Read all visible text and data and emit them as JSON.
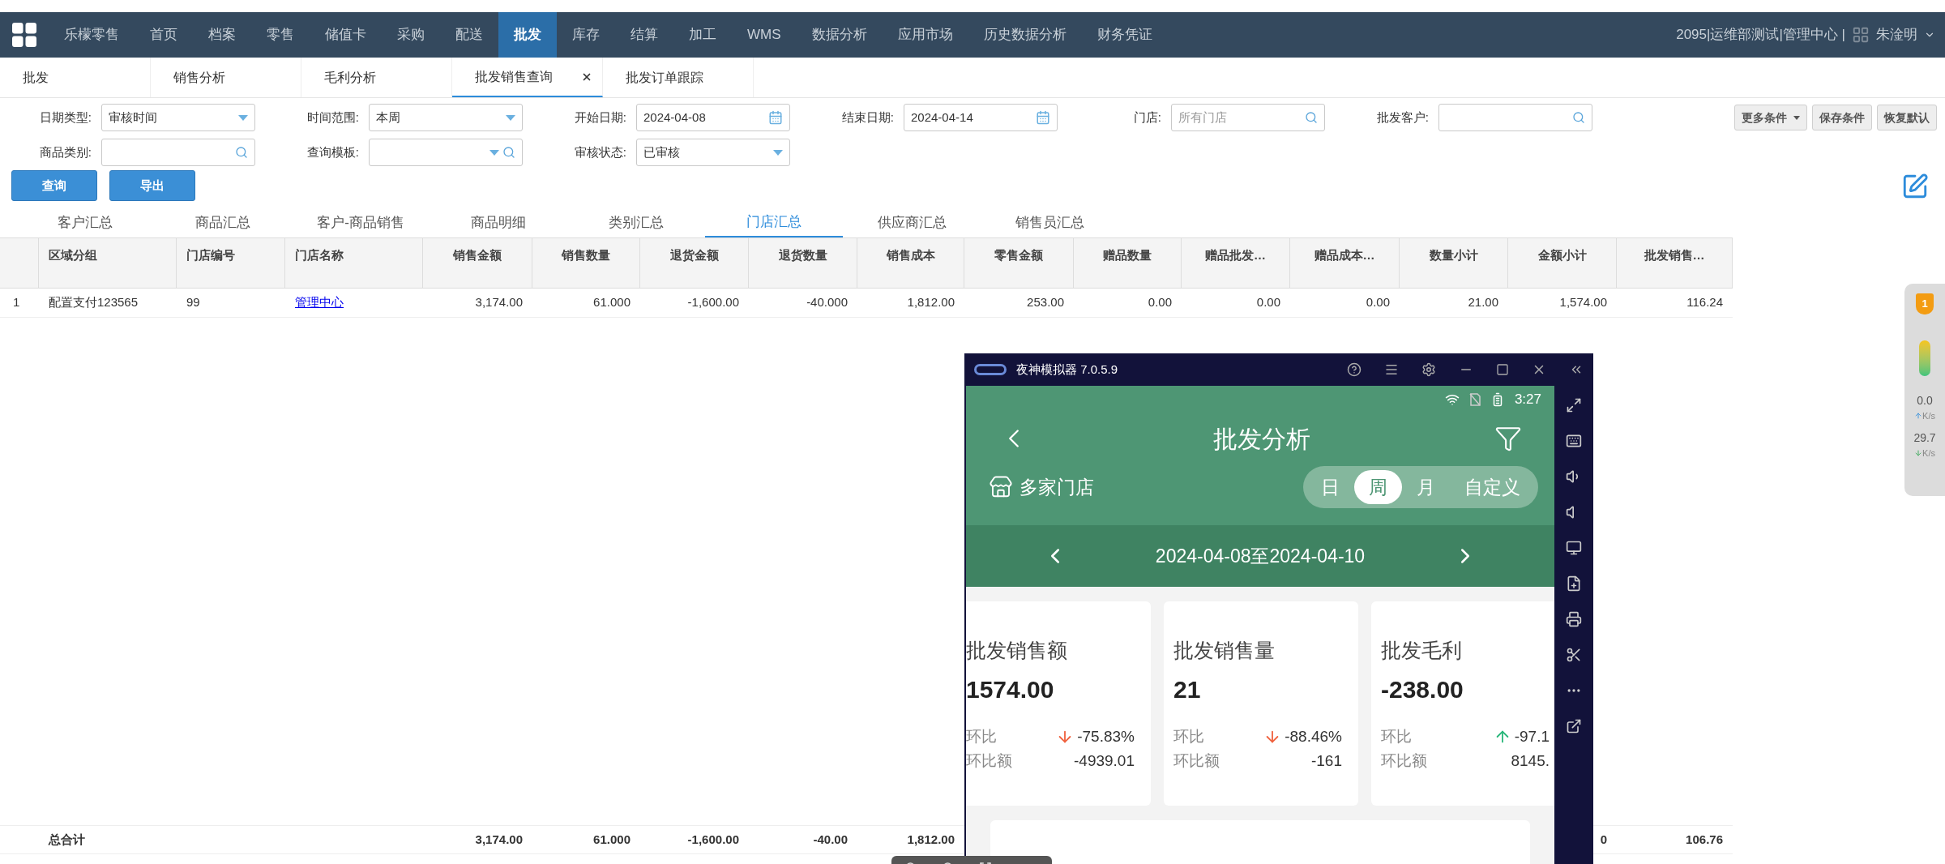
{
  "nav": {
    "items": [
      {
        "label": "乐檬零售",
        "selected": false
      },
      {
        "label": "首页",
        "selected": false
      },
      {
        "label": "档案",
        "selected": false
      },
      {
        "label": "零售",
        "selected": false
      },
      {
        "label": "储值卡",
        "selected": false
      },
      {
        "label": "采购",
        "selected": false
      },
      {
        "label": "配送",
        "selected": false
      },
      {
        "label": "批发",
        "selected": true
      },
      {
        "label": "库存",
        "selected": false
      },
      {
        "label": "结算",
        "selected": false
      },
      {
        "label": "加工",
        "selected": false
      },
      {
        "label": "WMS",
        "selected": false
      },
      {
        "label": "数据分析",
        "selected": false
      },
      {
        "label": "应用市场",
        "selected": false
      },
      {
        "label": "历史数据分析",
        "selected": false
      },
      {
        "label": "财务凭证",
        "selected": false
      }
    ],
    "org": "2095|运维部测试|管理中心 |",
    "user": "朱淦明"
  },
  "tabs": [
    {
      "label": "批发",
      "selected": false,
      "closable": false
    },
    {
      "label": "销售分析",
      "selected": false,
      "closable": false
    },
    {
      "label": "毛利分析",
      "selected": false,
      "closable": false
    },
    {
      "label": "批发销售查询",
      "selected": true,
      "closable": true
    },
    {
      "label": "批发订单跟踪",
      "selected": false,
      "closable": false
    }
  ],
  "filter_rows": [
    [
      {
        "label": "日期类型:",
        "kind": "select",
        "value": "审核时间"
      },
      {
        "label": "时间范围:",
        "kind": "select",
        "value": "本周"
      },
      {
        "label": "开始日期:",
        "kind": "date",
        "value": "2024-04-08"
      },
      {
        "label": "结束日期:",
        "kind": "date",
        "value": "2024-04-14"
      },
      {
        "label": "门店:",
        "kind": "search",
        "placeholder": "所有门店"
      },
      {
        "label": "批发客户:",
        "kind": "search"
      }
    ],
    [
      {
        "label": "商品类别:",
        "kind": "search"
      },
      {
        "label": "查询模板:",
        "kind": "select-search"
      },
      {
        "label": "审核状态:",
        "kind": "select",
        "value": "已审核"
      }
    ]
  ],
  "option_buttons": [
    {
      "label": "更多条件",
      "kind": "dropdown"
    },
    {
      "label": "保存条件",
      "kind": "plain"
    },
    {
      "label": "恢复默认",
      "kind": "plain"
    }
  ],
  "action_buttons": [
    "查询",
    "导出"
  ],
  "report_tabs": [
    {
      "label": "客户汇总",
      "selected": false
    },
    {
      "label": "商品汇总",
      "selected": false
    },
    {
      "label": "客户-商品销售",
      "selected": false
    },
    {
      "label": "商品明细",
      "selected": false
    },
    {
      "label": "类别汇总",
      "selected": false
    },
    {
      "label": "门店汇总",
      "selected": true
    },
    {
      "label": "供应商汇总",
      "selected": false
    },
    {
      "label": "销售员汇总",
      "selected": false
    }
  ],
  "table": {
    "columns": [
      {
        "label": "区域分组",
        "kind": "text"
      },
      {
        "label": "门店编号",
        "kind": "text"
      },
      {
        "label": "门店名称",
        "kind": "link"
      },
      {
        "label": "销售金额",
        "kind": "number"
      },
      {
        "label": "销售数量",
        "kind": "number"
      },
      {
        "label": "退货金额",
        "kind": "number"
      },
      {
        "label": "退货数量",
        "kind": "number"
      },
      {
        "label": "销售成本",
        "kind": "number"
      },
      {
        "label": "零售金额",
        "kind": "number"
      },
      {
        "label": "赠品数量",
        "kind": "number"
      },
      {
        "label": "赠品批发…",
        "kind": "number"
      },
      {
        "label": "赠品成本…",
        "kind": "number"
      },
      {
        "label": "数量小计",
        "kind": "number"
      },
      {
        "label": "金额小计",
        "kind": "number"
      },
      {
        "label": "批发销售…",
        "kind": "number"
      }
    ],
    "rows": [
      {
        "index": "1",
        "cells": [
          "配置支付123565",
          "99",
          "管理中心",
          "3,174.00",
          "61.000",
          "-1,600.00",
          "-40.000",
          "1,812.00",
          "253.00",
          "0.00",
          "0.00",
          "0.00",
          "21.00",
          "1,574.00",
          "116.24"
        ]
      }
    ],
    "footer": {
      "label": "总合计",
      "cells": [
        null,
        null,
        null,
        "3,174.00",
        "61.000",
        "-1,600.00",
        "-40.00",
        "1,812.00",
        null,
        null,
        null,
        null,
        null,
        "0",
        "106.76"
      ]
    }
  },
  "emulator": {
    "title": "夜神模拟器 7.0.5.9",
    "time": "3:27",
    "app_title": "批发分析",
    "store": "多家门店",
    "periods": [
      {
        "label": "日",
        "selected": false
      },
      {
        "label": "周",
        "selected": true
      },
      {
        "label": "月",
        "selected": false
      },
      {
        "label": "自定义",
        "selected": false
      }
    ],
    "date_range": "2024-04-08至2024-04-10",
    "cards": [
      {
        "title": "批发销售额",
        "value": "1574.00",
        "ratio_label": "环比",
        "ratio": "-75.83%",
        "rising": false,
        "amount_label": "环比额",
        "amount": "-4939.01"
      },
      {
        "title": "批发销售量",
        "value": "21",
        "ratio_label": "环比",
        "ratio": "-88.46%",
        "rising": false,
        "amount_label": "环比额",
        "amount": "-161"
      },
      {
        "title": "批发毛利",
        "value": "-238.00",
        "ratio_label": "环比",
        "ratio": "-97.1",
        "rising": true,
        "amount_label": "环比额",
        "amount": "8145."
      }
    ]
  },
  "side_widget": {
    "badge": "1",
    "upload": "0.0",
    "upload_unit": "K/s",
    "download": "29.7",
    "download_unit": "K/s"
  }
}
